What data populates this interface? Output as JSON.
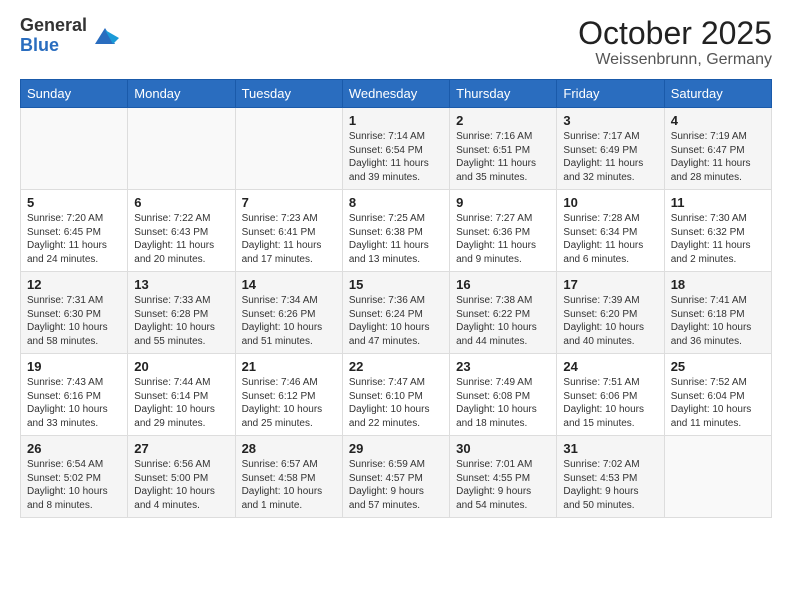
{
  "logo": {
    "general": "General",
    "blue": "Blue"
  },
  "title": "October 2025",
  "subtitle": "Weissenbrunn, Germany",
  "days_of_week": [
    "Sunday",
    "Monday",
    "Tuesday",
    "Wednesday",
    "Thursday",
    "Friday",
    "Saturday"
  ],
  "weeks": [
    [
      {
        "day": "",
        "info": ""
      },
      {
        "day": "",
        "info": ""
      },
      {
        "day": "",
        "info": ""
      },
      {
        "day": "1",
        "info": "Sunrise: 7:14 AM\nSunset: 6:54 PM\nDaylight: 11 hours\nand 39 minutes."
      },
      {
        "day": "2",
        "info": "Sunrise: 7:16 AM\nSunset: 6:51 PM\nDaylight: 11 hours\nand 35 minutes."
      },
      {
        "day": "3",
        "info": "Sunrise: 7:17 AM\nSunset: 6:49 PM\nDaylight: 11 hours\nand 32 minutes."
      },
      {
        "day": "4",
        "info": "Sunrise: 7:19 AM\nSunset: 6:47 PM\nDaylight: 11 hours\nand 28 minutes."
      }
    ],
    [
      {
        "day": "5",
        "info": "Sunrise: 7:20 AM\nSunset: 6:45 PM\nDaylight: 11 hours\nand 24 minutes."
      },
      {
        "day": "6",
        "info": "Sunrise: 7:22 AM\nSunset: 6:43 PM\nDaylight: 11 hours\nand 20 minutes."
      },
      {
        "day": "7",
        "info": "Sunrise: 7:23 AM\nSunset: 6:41 PM\nDaylight: 11 hours\nand 17 minutes."
      },
      {
        "day": "8",
        "info": "Sunrise: 7:25 AM\nSunset: 6:38 PM\nDaylight: 11 hours\nand 13 minutes."
      },
      {
        "day": "9",
        "info": "Sunrise: 7:27 AM\nSunset: 6:36 PM\nDaylight: 11 hours\nand 9 minutes."
      },
      {
        "day": "10",
        "info": "Sunrise: 7:28 AM\nSunset: 6:34 PM\nDaylight: 11 hours\nand 6 minutes."
      },
      {
        "day": "11",
        "info": "Sunrise: 7:30 AM\nSunset: 6:32 PM\nDaylight: 11 hours\nand 2 minutes."
      }
    ],
    [
      {
        "day": "12",
        "info": "Sunrise: 7:31 AM\nSunset: 6:30 PM\nDaylight: 10 hours\nand 58 minutes."
      },
      {
        "day": "13",
        "info": "Sunrise: 7:33 AM\nSunset: 6:28 PM\nDaylight: 10 hours\nand 55 minutes."
      },
      {
        "day": "14",
        "info": "Sunrise: 7:34 AM\nSunset: 6:26 PM\nDaylight: 10 hours\nand 51 minutes."
      },
      {
        "day": "15",
        "info": "Sunrise: 7:36 AM\nSunset: 6:24 PM\nDaylight: 10 hours\nand 47 minutes."
      },
      {
        "day": "16",
        "info": "Sunrise: 7:38 AM\nSunset: 6:22 PM\nDaylight: 10 hours\nand 44 minutes."
      },
      {
        "day": "17",
        "info": "Sunrise: 7:39 AM\nSunset: 6:20 PM\nDaylight: 10 hours\nand 40 minutes."
      },
      {
        "day": "18",
        "info": "Sunrise: 7:41 AM\nSunset: 6:18 PM\nDaylight: 10 hours\nand 36 minutes."
      }
    ],
    [
      {
        "day": "19",
        "info": "Sunrise: 7:43 AM\nSunset: 6:16 PM\nDaylight: 10 hours\nand 33 minutes."
      },
      {
        "day": "20",
        "info": "Sunrise: 7:44 AM\nSunset: 6:14 PM\nDaylight: 10 hours\nand 29 minutes."
      },
      {
        "day": "21",
        "info": "Sunrise: 7:46 AM\nSunset: 6:12 PM\nDaylight: 10 hours\nand 25 minutes."
      },
      {
        "day": "22",
        "info": "Sunrise: 7:47 AM\nSunset: 6:10 PM\nDaylight: 10 hours\nand 22 minutes."
      },
      {
        "day": "23",
        "info": "Sunrise: 7:49 AM\nSunset: 6:08 PM\nDaylight: 10 hours\nand 18 minutes."
      },
      {
        "day": "24",
        "info": "Sunrise: 7:51 AM\nSunset: 6:06 PM\nDaylight: 10 hours\nand 15 minutes."
      },
      {
        "day": "25",
        "info": "Sunrise: 7:52 AM\nSunset: 6:04 PM\nDaylight: 10 hours\nand 11 minutes."
      }
    ],
    [
      {
        "day": "26",
        "info": "Sunrise: 6:54 AM\nSunset: 5:02 PM\nDaylight: 10 hours\nand 8 minutes."
      },
      {
        "day": "27",
        "info": "Sunrise: 6:56 AM\nSunset: 5:00 PM\nDaylight: 10 hours\nand 4 minutes."
      },
      {
        "day": "28",
        "info": "Sunrise: 6:57 AM\nSunset: 4:58 PM\nDaylight: 10 hours\nand 1 minute."
      },
      {
        "day": "29",
        "info": "Sunrise: 6:59 AM\nSunset: 4:57 PM\nDaylight: 9 hours\nand 57 minutes."
      },
      {
        "day": "30",
        "info": "Sunrise: 7:01 AM\nSunset: 4:55 PM\nDaylight: 9 hours\nand 54 minutes."
      },
      {
        "day": "31",
        "info": "Sunrise: 7:02 AM\nSunset: 4:53 PM\nDaylight: 9 hours\nand 50 minutes."
      },
      {
        "day": "",
        "info": ""
      }
    ]
  ],
  "accent_color": "#2a6dbf"
}
